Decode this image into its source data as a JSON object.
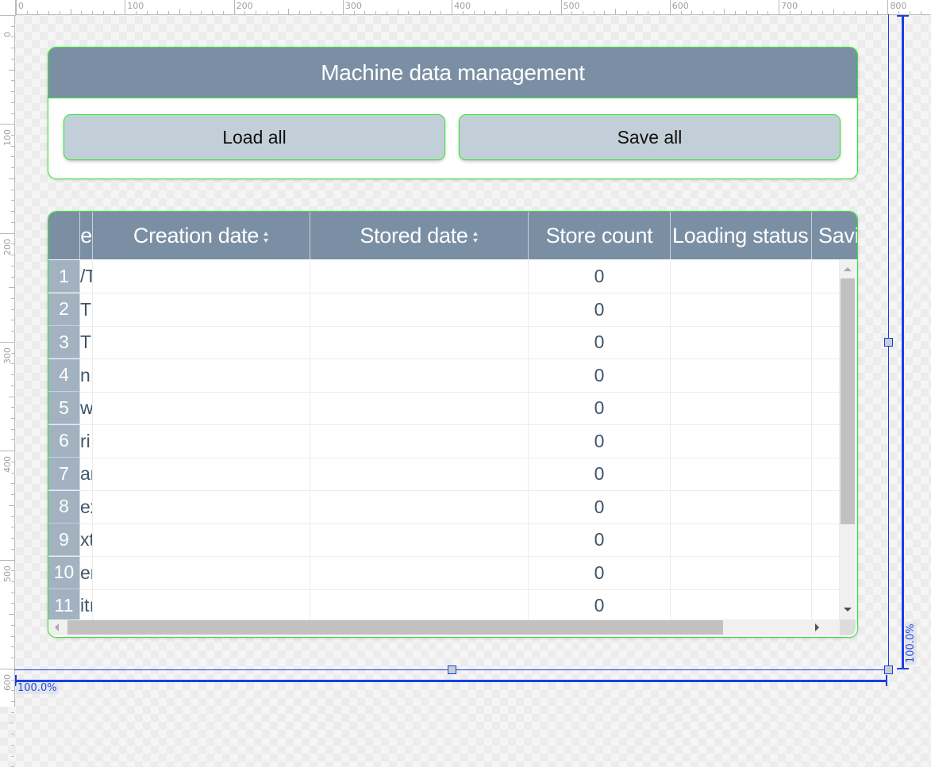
{
  "rulers": {
    "top_labels": [
      "0",
      "100",
      "200",
      "300",
      "400",
      "500",
      "600",
      "700",
      "800"
    ],
    "left_labels": [
      "0",
      "100",
      "200",
      "300",
      "400",
      "500",
      "600"
    ]
  },
  "top_panel": {
    "title": "Machine data management",
    "load_button": "Load all",
    "save_button": "Save all"
  },
  "table": {
    "columns": [
      {
        "label": "le",
        "sortable": false
      },
      {
        "label": "Creation date",
        "sortable": true
      },
      {
        "label": "Stored date",
        "sortable": true
      },
      {
        "label": "Store count",
        "sortable": false
      },
      {
        "label": "Loading status",
        "sortable": false
      },
      {
        "label": "Savi",
        "sortable": false
      }
    ],
    "rows": [
      {
        "num": "1",
        "name": "/T",
        "creation_date": "",
        "stored_date": "",
        "store_count": "0",
        "loading_status": "",
        "saving_status": ""
      },
      {
        "num": "2",
        "name": "T",
        "creation_date": "",
        "stored_date": "",
        "store_count": "0",
        "loading_status": "",
        "saving_status": ""
      },
      {
        "num": "3",
        "name": "T",
        "creation_date": "",
        "stored_date": "",
        "store_count": "0",
        "loading_status": "",
        "saving_status": ""
      },
      {
        "num": "4",
        "name": "nı",
        "creation_date": "",
        "stored_date": "",
        "store_count": "0",
        "loading_status": "",
        "saving_status": ""
      },
      {
        "num": "5",
        "name": "w",
        "creation_date": "",
        "stored_date": "",
        "store_count": "0",
        "loading_status": "",
        "saving_status": ""
      },
      {
        "num": "6",
        "name": "ri",
        "creation_date": "",
        "stored_date": "",
        "store_count": "0",
        "loading_status": "",
        "saving_status": ""
      },
      {
        "num": "7",
        "name": "ar",
        "creation_date": "",
        "stored_date": "",
        "store_count": "0",
        "loading_status": "",
        "saving_status": ""
      },
      {
        "num": "8",
        "name": "ex",
        "creation_date": "",
        "stored_date": "",
        "store_count": "0",
        "loading_status": "",
        "saving_status": ""
      },
      {
        "num": "9",
        "name": "xtı",
        "creation_date": "",
        "stored_date": "",
        "store_count": "0",
        "loading_status": "",
        "saving_status": ""
      },
      {
        "num": "10",
        "name": "er",
        "creation_date": "",
        "stored_date": "",
        "store_count": "0",
        "loading_status": "",
        "saving_status": ""
      },
      {
        "num": "11",
        "name": "itı",
        "creation_date": "",
        "stored_date": "",
        "store_count": "0",
        "loading_status": "",
        "saving_status": ""
      }
    ],
    "vertical_scroll_fraction": 0,
    "horizontal_scroll_fraction": 0
  },
  "guides": {
    "width_label": "100.0%",
    "height_label": "100.0%"
  },
  "colors": {
    "header_bg": "#7b8fa4",
    "button_bg": "#c3cfd8",
    "rownum_bg": "#a3b2c0",
    "selection_outline": "#2ee82e",
    "guide_blue": "#1a3fe0"
  }
}
